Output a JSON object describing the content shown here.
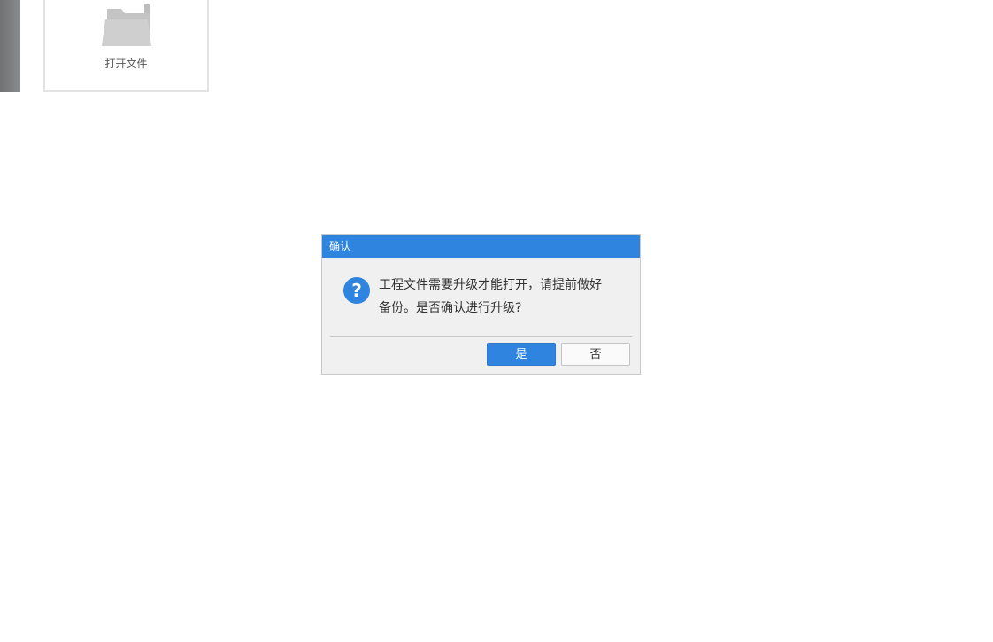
{
  "launcher": {
    "open_file_label": "打开文件",
    "folder_icon": "folder-icon"
  },
  "dialog": {
    "title": "确认",
    "icon": "question-icon",
    "message_line1": "工程文件需要升级才能打开，请提前做好",
    "message_line2": "备份。是否确认进行升级?",
    "yes_label": "是",
    "no_label": "否"
  },
  "colors": {
    "accent": "#2f84e0",
    "dialog_background": "#f0f0f0",
    "sidebar_strip": "#7a7c7e"
  }
}
